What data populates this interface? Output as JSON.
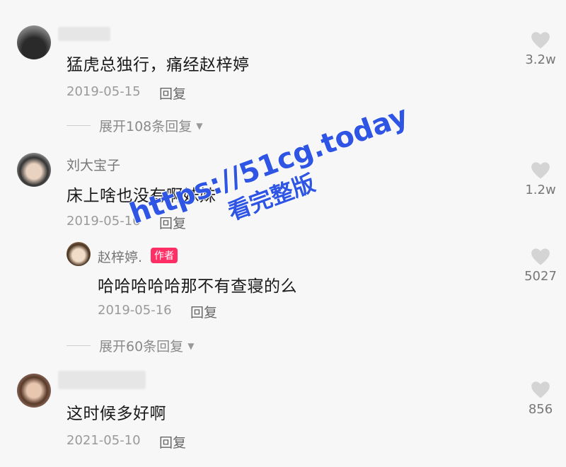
{
  "comments": [
    {
      "name": "",
      "text": "猛虎总独行，痛经赵梓婷",
      "date": "2019-05-15",
      "reply_label": "回复",
      "likes": "3.2w",
      "expand_label": "展开108条回复"
    },
    {
      "name": "刘大宝子",
      "text": "床上啥也没有啊妹妹",
      "date": "2019-05-16",
      "reply_label": "回复",
      "likes": "1.2w",
      "sub_reply": {
        "name": "赵梓婷.",
        "badge": "作者",
        "text": "哈哈哈哈哈那不有查寝的么",
        "date": "2019-05-16",
        "reply_label": "回复",
        "likes": "5027"
      },
      "expand_label": "展开60条回复"
    },
    {
      "name": "",
      "text": "这时候多好啊",
      "date": "2021-05-10",
      "reply_label": "回复",
      "likes": "856"
    }
  ],
  "watermark": {
    "line1": "https://51cg.today",
    "line2": "看完整版"
  },
  "colors": {
    "badge": "#ff2f66",
    "watermark": "#2f55e5",
    "background": "#f7f7f7"
  },
  "icons": {
    "like": "heart-icon",
    "expand": "triangle-down-icon"
  }
}
